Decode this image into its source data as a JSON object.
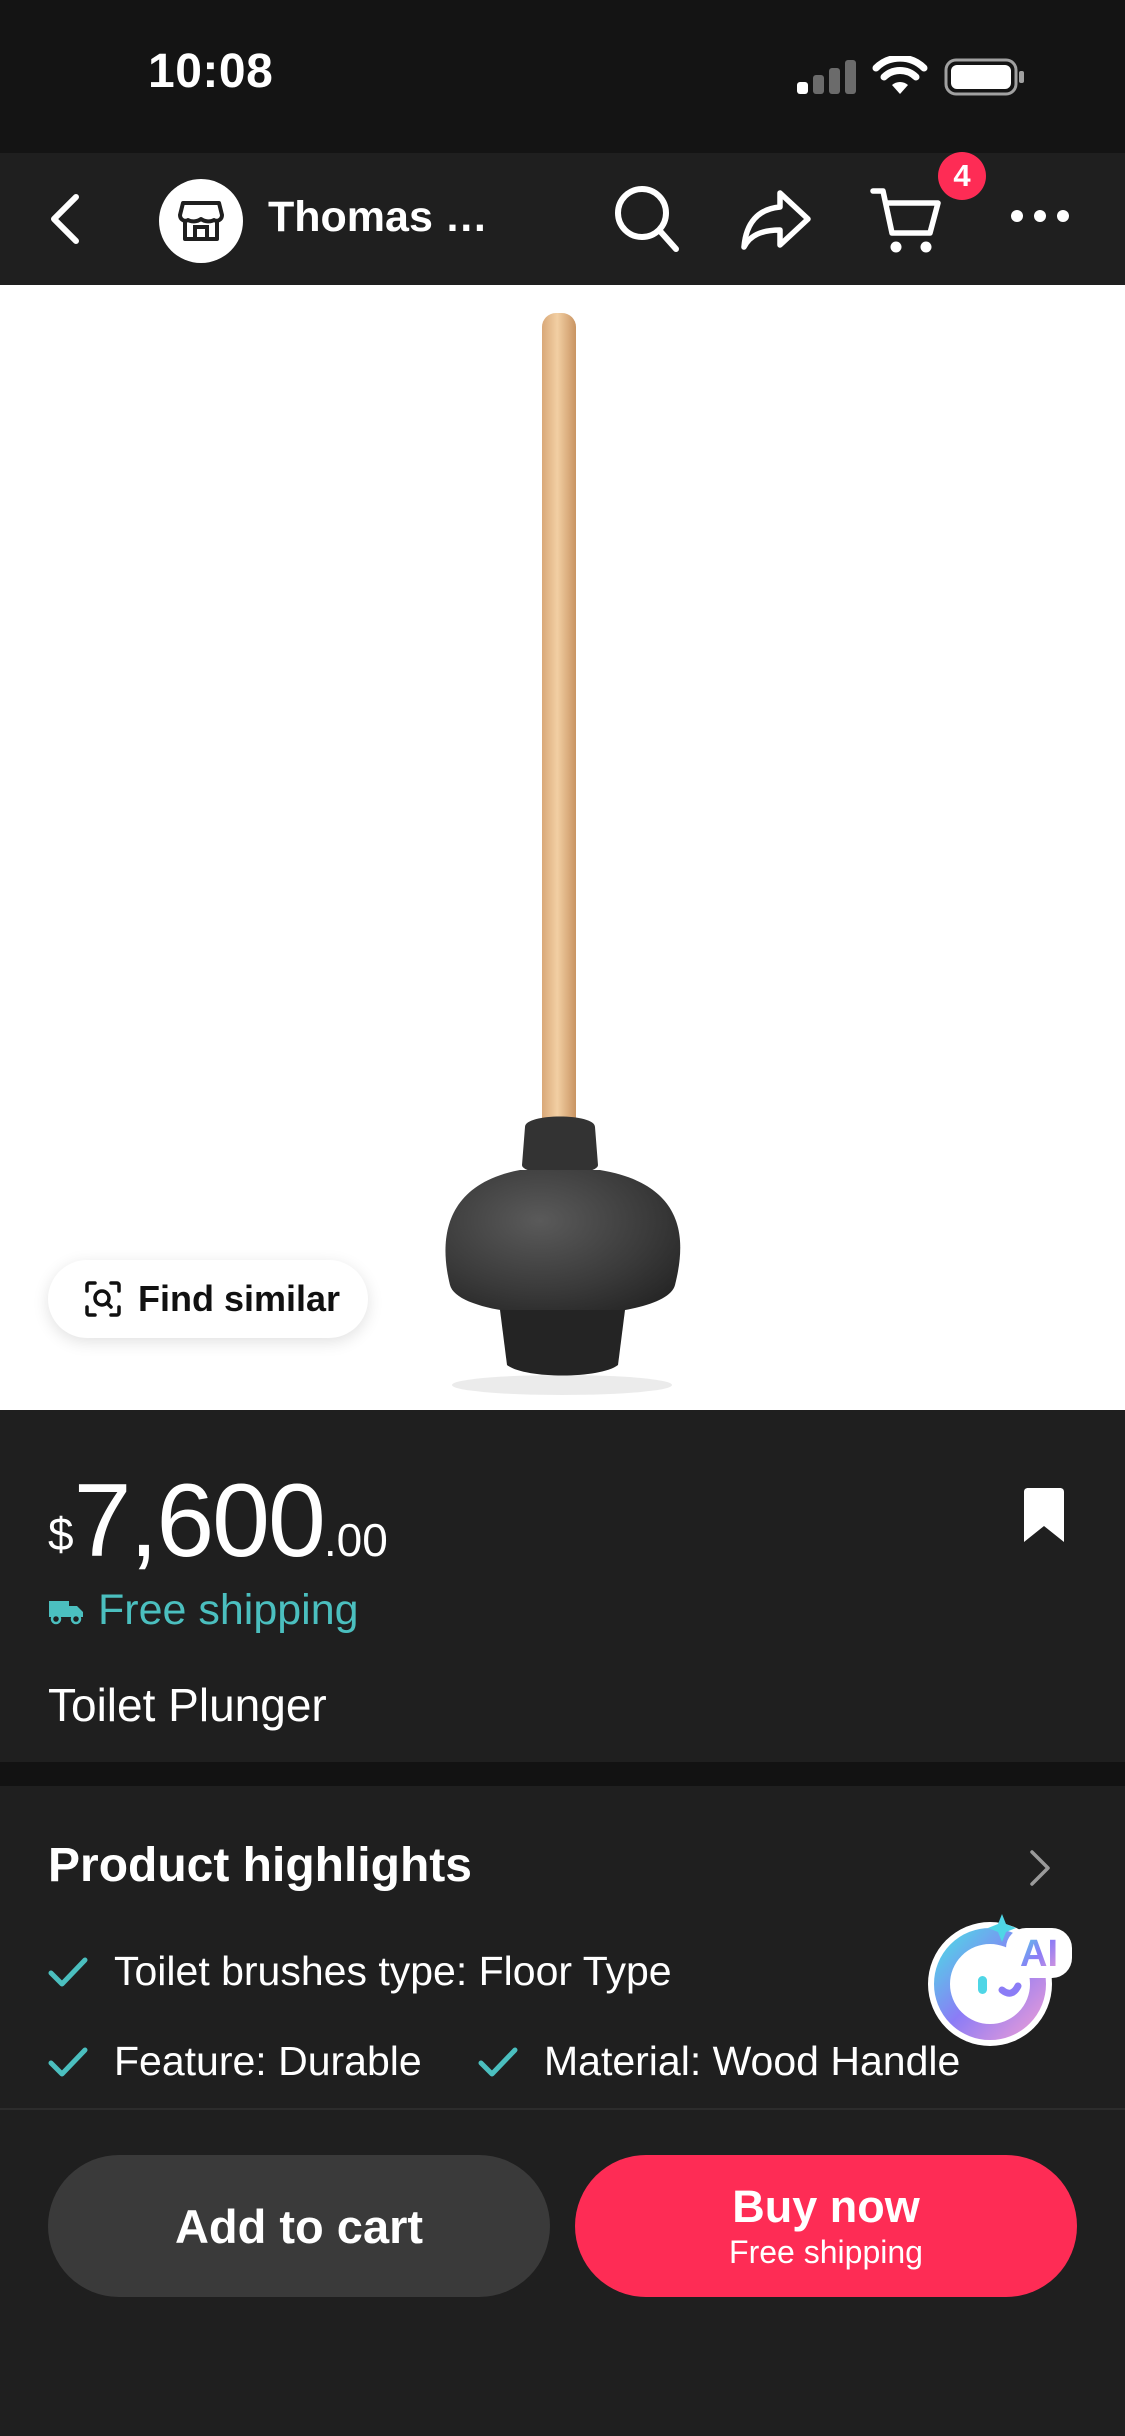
{
  "status_bar": {
    "time": "10:08"
  },
  "nav": {
    "shop_name": "Thomas …",
    "cart_count": "4",
    "icons": [
      "back-icon",
      "store-icon",
      "search-icon",
      "share-icon",
      "cart-icon",
      "more-icon"
    ]
  },
  "product_image": {
    "find_similar_label": "Find similar"
  },
  "info": {
    "currency": "$",
    "price_integer": "7,600",
    "price_decimal": ".00",
    "shipping_label": "Free shipping",
    "title": "Toilet Plunger"
  },
  "highlights": {
    "title": "Product highlights",
    "items": [
      "Toilet brushes type: Floor Type",
      "Feature: Durable",
      "Material: Wood Handle"
    ],
    "ai_label": "AI"
  },
  "actions": {
    "add_to_cart": "Add to cart",
    "buy_now": "Buy now",
    "buy_now_sub": "Free shipping"
  },
  "colors": {
    "accent": "#fe2c55",
    "shipping": "#4bbfbf",
    "background": "#1f1f1f"
  }
}
